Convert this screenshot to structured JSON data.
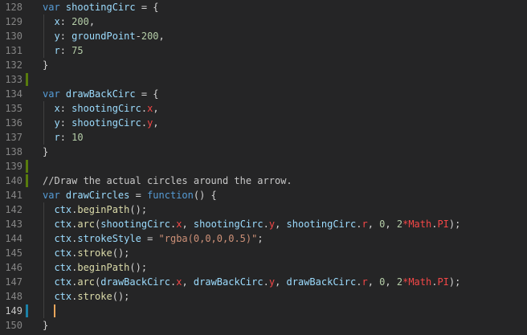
{
  "colors": {
    "background": "#252526",
    "line_number": "#858585",
    "line_number_active": "#c6c6c6",
    "default": "#d4d4d4",
    "keyword": "#569cd6",
    "variable": "#9cdcfe",
    "property": "#9cdcfe",
    "number": "#b5cea8",
    "string": "#ce9178",
    "function": "#dcdcaa",
    "comment": "#c8c8c8",
    "operator": "#d4d4d4",
    "highlight": "#f44747",
    "gutter_added": "#587c0c",
    "gutter_modified": "#1b81a8",
    "cursor": "#e8a55b"
  },
  "editor": {
    "active_line": 149,
    "lines": [
      {
        "n": "128",
        "gutter": "",
        "tokens": [
          [
            "var ",
            "keyword"
          ],
          [
            "shootingCirc",
            "variable"
          ],
          [
            " = {",
            "default"
          ]
        ]
      },
      {
        "n": "129",
        "gutter": "",
        "tokens": [
          [
            "  x",
            "property"
          ],
          [
            ": ",
            "default"
          ],
          [
            "200",
            "number"
          ],
          [
            ",",
            "default"
          ]
        ]
      },
      {
        "n": "130",
        "gutter": "",
        "tokens": [
          [
            "  y",
            "property"
          ],
          [
            ": ",
            "default"
          ],
          [
            "groundPoint",
            "variable"
          ],
          [
            "-",
            "operator"
          ],
          [
            "200",
            "number"
          ],
          [
            ",",
            "default"
          ]
        ]
      },
      {
        "n": "131",
        "gutter": "",
        "tokens": [
          [
            "  r",
            "property"
          ],
          [
            ": ",
            "default"
          ],
          [
            "75",
            "number"
          ]
        ]
      },
      {
        "n": "132",
        "gutter": "",
        "tokens": [
          [
            "}",
            "default"
          ]
        ]
      },
      {
        "n": "133",
        "gutter": "added",
        "tokens": []
      },
      {
        "n": "134",
        "gutter": "",
        "tokens": [
          [
            "var ",
            "keyword"
          ],
          [
            "drawBackCirc",
            "variable"
          ],
          [
            " = {",
            "default"
          ]
        ]
      },
      {
        "n": "135",
        "gutter": "",
        "tokens": [
          [
            "  x",
            "property"
          ],
          [
            ": ",
            "default"
          ],
          [
            "shootingCirc",
            "variable"
          ],
          [
            ".",
            "default"
          ],
          [
            "x",
            "highlight"
          ],
          [
            ",",
            "default"
          ]
        ]
      },
      {
        "n": "136",
        "gutter": "",
        "tokens": [
          [
            "  y",
            "property"
          ],
          [
            ": ",
            "default"
          ],
          [
            "shootingCirc",
            "variable"
          ],
          [
            ".",
            "default"
          ],
          [
            "y",
            "highlight"
          ],
          [
            ",",
            "default"
          ]
        ]
      },
      {
        "n": "137",
        "gutter": "",
        "tokens": [
          [
            "  r",
            "property"
          ],
          [
            ": ",
            "default"
          ],
          [
            "10",
            "number"
          ]
        ]
      },
      {
        "n": "138",
        "gutter": "",
        "tokens": [
          [
            "}",
            "default"
          ]
        ]
      },
      {
        "n": "139",
        "gutter": "added",
        "tokens": []
      },
      {
        "n": "140",
        "gutter": "added",
        "tokens": [
          [
            "//Draw the actual circles around the arrow.",
            "comment"
          ]
        ]
      },
      {
        "n": "141",
        "gutter": "",
        "tokens": [
          [
            "var ",
            "keyword"
          ],
          [
            "drawCircles",
            "variable"
          ],
          [
            " = ",
            "default"
          ],
          [
            "function",
            "keyword"
          ],
          [
            "() {",
            "default"
          ]
        ]
      },
      {
        "n": "142",
        "gutter": "",
        "tokens": [
          [
            "  ctx",
            "variable"
          ],
          [
            ".",
            "default"
          ],
          [
            "beginPath",
            "function"
          ],
          [
            "();",
            "default"
          ]
        ]
      },
      {
        "n": "143",
        "gutter": "",
        "tokens": [
          [
            "  ctx",
            "variable"
          ],
          [
            ".",
            "default"
          ],
          [
            "arc",
            "function"
          ],
          [
            "(",
            "default"
          ],
          [
            "shootingCirc",
            "variable"
          ],
          [
            ".",
            "default"
          ],
          [
            "x",
            "highlight"
          ],
          [
            ", ",
            "default"
          ],
          [
            "shootingCirc",
            "variable"
          ],
          [
            ".",
            "default"
          ],
          [
            "y",
            "highlight"
          ],
          [
            ", ",
            "default"
          ],
          [
            "shootingCirc",
            "variable"
          ],
          [
            ".",
            "default"
          ],
          [
            "r",
            "highlight"
          ],
          [
            ", ",
            "default"
          ],
          [
            "0",
            "number"
          ],
          [
            ", ",
            "default"
          ],
          [
            "2",
            "number"
          ],
          [
            "*",
            "highlight"
          ],
          [
            "Math",
            "highlight"
          ],
          [
            ".",
            "default"
          ],
          [
            "PI",
            "highlight"
          ],
          [
            ");",
            "default"
          ]
        ]
      },
      {
        "n": "144",
        "gutter": "",
        "tokens": [
          [
            "  ctx",
            "variable"
          ],
          [
            ".",
            "default"
          ],
          [
            "strokeStyle",
            "property"
          ],
          [
            " = ",
            "default"
          ],
          [
            "\"rgba(0,0,0,0.5)\"",
            "string"
          ],
          [
            ";",
            "default"
          ]
        ]
      },
      {
        "n": "145",
        "gutter": "",
        "tokens": [
          [
            "  ctx",
            "variable"
          ],
          [
            ".",
            "default"
          ],
          [
            "stroke",
            "function"
          ],
          [
            "();",
            "default"
          ]
        ]
      },
      {
        "n": "146",
        "gutter": "",
        "tokens": [
          [
            "  ctx",
            "variable"
          ],
          [
            ".",
            "default"
          ],
          [
            "beginPath",
            "function"
          ],
          [
            "();",
            "default"
          ]
        ]
      },
      {
        "n": "147",
        "gutter": "",
        "tokens": [
          [
            "  ctx",
            "variable"
          ],
          [
            ".",
            "default"
          ],
          [
            "arc",
            "function"
          ],
          [
            "(",
            "default"
          ],
          [
            "drawBackCirc",
            "variable"
          ],
          [
            ".",
            "default"
          ],
          [
            "x",
            "highlight"
          ],
          [
            ", ",
            "default"
          ],
          [
            "drawBackCirc",
            "variable"
          ],
          [
            ".",
            "default"
          ],
          [
            "y",
            "highlight"
          ],
          [
            ", ",
            "default"
          ],
          [
            "drawBackCirc",
            "variable"
          ],
          [
            ".",
            "default"
          ],
          [
            "r",
            "highlight"
          ],
          [
            ", ",
            "default"
          ],
          [
            "0",
            "number"
          ],
          [
            ", ",
            "default"
          ],
          [
            "2",
            "number"
          ],
          [
            "*",
            "highlight"
          ],
          [
            "Math",
            "highlight"
          ],
          [
            ".",
            "default"
          ],
          [
            "PI",
            "highlight"
          ],
          [
            ");",
            "default"
          ]
        ]
      },
      {
        "n": "148",
        "gutter": "",
        "tokens": [
          [
            "  ctx",
            "variable"
          ],
          [
            ".",
            "default"
          ],
          [
            "stroke",
            "function"
          ],
          [
            "();",
            "default"
          ]
        ]
      },
      {
        "n": "149",
        "gutter": "modified",
        "tokens": []
      },
      {
        "n": "150",
        "gutter": "",
        "tokens": [
          [
            "}",
            "default"
          ]
        ]
      }
    ]
  }
}
